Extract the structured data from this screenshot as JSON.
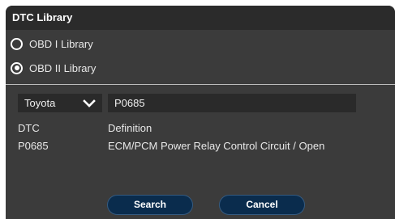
{
  "dialog": {
    "title": "DTC Library"
  },
  "library_options": [
    {
      "label": "OBD I Library",
      "selected": false
    },
    {
      "label": "OBD II Library",
      "selected": true
    }
  ],
  "make_select": {
    "value": "Toyota"
  },
  "code_input": {
    "value": "P0685"
  },
  "results": {
    "headers": [
      "DTC",
      "Definition"
    ],
    "rows": [
      [
        "P0685",
        "ECM/PCM Power Relay Control Circuit / Open"
      ]
    ]
  },
  "buttons": {
    "search_label": "Search",
    "cancel_label": "Cancel"
  },
  "icons": {
    "make_dropdown": "chevron-down-icon"
  },
  "colors": {
    "dialog_bg": "#3b3b3b",
    "titlebar_bg": "#2b2b2b",
    "field_bg": "#2a2a2a",
    "button_bg": "#0a2c4d",
    "text": "#ffffff"
  }
}
